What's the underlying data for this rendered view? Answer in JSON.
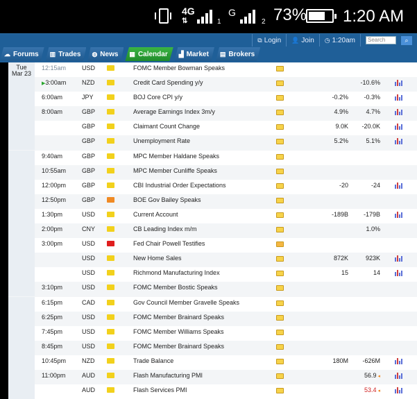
{
  "status_bar": {
    "network": "4G",
    "sim1": "1",
    "sim2_network": "G",
    "sim2": "2",
    "battery_percent": "73%",
    "battery_level": 0.73,
    "time": "1:20 AM"
  },
  "header": {
    "login": "Login",
    "join": "Join",
    "clock": "1:20am",
    "search_placeholder": "Search",
    "tabs": [
      "Forums",
      "Trades",
      "News",
      "Calendar",
      "Market",
      "Brokers"
    ],
    "active_tab": "Calendar"
  },
  "calendar": {
    "date_line1": "Tue",
    "date_line2": "Mar 23",
    "rows": [
      {
        "time": "12:15am",
        "currency": "USD",
        "impact": "yellow",
        "event": "FOMC Member Bowman Speaks",
        "actual": "",
        "forecast": "",
        "previous": "",
        "chart": false,
        "time_color": "#7a8a9a"
      },
      {
        "time": "3:00am",
        "currency": "NZD",
        "impact": "yellow",
        "event": "Credit Card Spending y/y",
        "actual": "",
        "forecast": "",
        "previous": "-10.6%",
        "chart": true,
        "current": true
      },
      {
        "time": "6:00am",
        "currency": "JPY",
        "impact": "yellow",
        "event": "BOJ Core CPI y/y",
        "actual": "",
        "forecast": "-0.2%",
        "previous": "-0.3%",
        "chart": true
      },
      {
        "time": "8:00am",
        "currency": "GBP",
        "impact": "yellow",
        "event": "Average Earnings Index 3m/y",
        "actual": "",
        "forecast": "4.9%",
        "previous": "4.7%",
        "chart": true
      },
      {
        "time": "",
        "currency": "GBP",
        "impact": "yellow",
        "event": "Claimant Count Change",
        "actual": "",
        "forecast": "9.0K",
        "previous": "-20.0K",
        "chart": true
      },
      {
        "time": "",
        "currency": "GBP",
        "impact": "yellow",
        "event": "Unemployment Rate",
        "actual": "",
        "forecast": "5.2%",
        "previous": "5.1%",
        "chart": true
      },
      {
        "time": "9:40am",
        "currency": "GBP",
        "impact": "yellow",
        "event": "MPC Member Haldane Speaks",
        "actual": "",
        "forecast": "",
        "previous": "",
        "chart": false
      },
      {
        "time": "10:55am",
        "currency": "GBP",
        "impact": "yellow",
        "event": "MPC Member Cunliffe Speaks",
        "actual": "",
        "forecast": "",
        "previous": "",
        "chart": false
      },
      {
        "time": "12:00pm",
        "currency": "GBP",
        "impact": "yellow",
        "event": "CBI Industrial Order Expectations",
        "actual": "",
        "forecast": "-20",
        "previous": "-24",
        "chart": true
      },
      {
        "time": "12:50pm",
        "currency": "GBP",
        "impact": "orange",
        "event": "BOE Gov Bailey Speaks",
        "actual": "",
        "forecast": "",
        "previous": "",
        "chart": false
      },
      {
        "time": "1:30pm",
        "currency": "USD",
        "impact": "yellow",
        "event": "Current Account",
        "actual": "",
        "forecast": "-189B",
        "previous": "-179B",
        "chart": true
      },
      {
        "time": "2:00pm",
        "currency": "CNY",
        "impact": "yellow",
        "event": "CB Leading Index m/m",
        "actual": "",
        "forecast": "",
        "previous": "1.0%",
        "chart": false
      },
      {
        "time": "3:00pm",
        "currency": "USD",
        "impact": "red",
        "event": "Fed Chair Powell Testifies",
        "actual": "",
        "forecast": "",
        "previous": "",
        "chart": false
      },
      {
        "time": "",
        "currency": "USD",
        "impact": "yellow",
        "event": "New Home Sales",
        "actual": "",
        "forecast": "872K",
        "previous": "923K",
        "chart": true
      },
      {
        "time": "",
        "currency": "USD",
        "impact": "yellow",
        "event": "Richmond Manufacturing Index",
        "actual": "",
        "forecast": "15",
        "previous": "14",
        "chart": true
      },
      {
        "time": "3:10pm",
        "currency": "USD",
        "impact": "yellow",
        "event": "FOMC Member Bostic Speaks",
        "actual": "",
        "forecast": "",
        "previous": "",
        "chart": false
      },
      {
        "time": "6:15pm",
        "currency": "CAD",
        "impact": "yellow",
        "event": "Gov Council Member Gravelle Speaks",
        "actual": "",
        "forecast": "",
        "previous": "",
        "chart": false
      },
      {
        "time": "6:25pm",
        "currency": "USD",
        "impact": "yellow",
        "event": "FOMC Member Brainard Speaks",
        "actual": "",
        "forecast": "",
        "previous": "",
        "chart": false
      },
      {
        "time": "7:45pm",
        "currency": "USD",
        "impact": "yellow",
        "event": "FOMC Member Williams Speaks",
        "actual": "",
        "forecast": "",
        "previous": "",
        "chart": false
      },
      {
        "time": "8:45pm",
        "currency": "USD",
        "impact": "yellow",
        "event": "FOMC Member Brainard Speaks",
        "actual": "",
        "forecast": "",
        "previous": "",
        "chart": false
      },
      {
        "time": "10:45pm",
        "currency": "NZD",
        "impact": "yellow",
        "event": "Trade Balance",
        "actual": "",
        "forecast": "180M",
        "previous": "-626M",
        "chart": true
      },
      {
        "time": "11:00pm",
        "currency": "AUD",
        "impact": "yellow",
        "event": "Flash Manufacturing PMI",
        "actual": "",
        "forecast": "",
        "previous": "56.9",
        "chart": true,
        "revised": true
      },
      {
        "time": "",
        "currency": "AUD",
        "impact": "yellow",
        "event": "Flash Services PMI",
        "actual": "",
        "forecast": "",
        "previous": "53.4",
        "chart": true,
        "revised": true,
        "previous_color": "#d02020"
      }
    ]
  },
  "colors": {
    "header_blue": "#1f5f98",
    "active_tab_green": "#2ea13a",
    "impact_yellow": "#f2d11c",
    "impact_orange": "#f08a24",
    "impact_red": "#e01e1e"
  }
}
